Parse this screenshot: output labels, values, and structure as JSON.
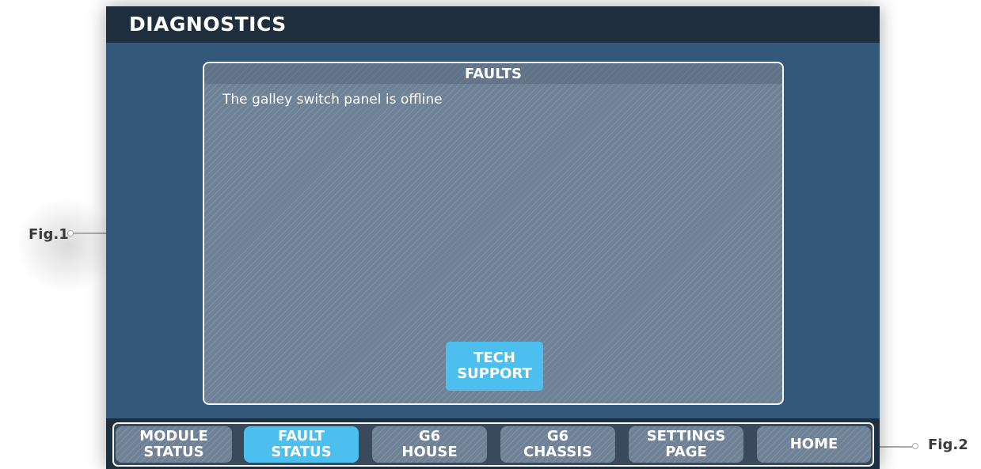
{
  "header": {
    "title": "DIAGNOSTICS"
  },
  "faults_panel": {
    "title": "FAULTS",
    "items": [
      "The galley switch panel is offline"
    ],
    "tech_support": {
      "line1": "TECH",
      "line2": "SUPPORT"
    }
  },
  "nav": {
    "buttons": [
      {
        "line1": "MODULE",
        "line2": "STATUS",
        "active": false
      },
      {
        "line1": "FAULT",
        "line2": "STATUS",
        "active": true
      },
      {
        "line1": "G6",
        "line2": "HOUSE",
        "active": false
      },
      {
        "line1": "G6",
        "line2": "CHASSIS",
        "active": false
      },
      {
        "line1": "SETTINGS",
        "line2": "PAGE",
        "active": false
      },
      {
        "line1": "HOME",
        "line2": "",
        "active": false
      }
    ]
  },
  "annotations": {
    "fig1": "Fig.1",
    "fig2": "Fig.2"
  },
  "colors": {
    "screen_bg": "#34587a",
    "header_bg": "#1f2e3d",
    "active_accent": "#4dbfef",
    "panel_fill": "#6e8196"
  }
}
